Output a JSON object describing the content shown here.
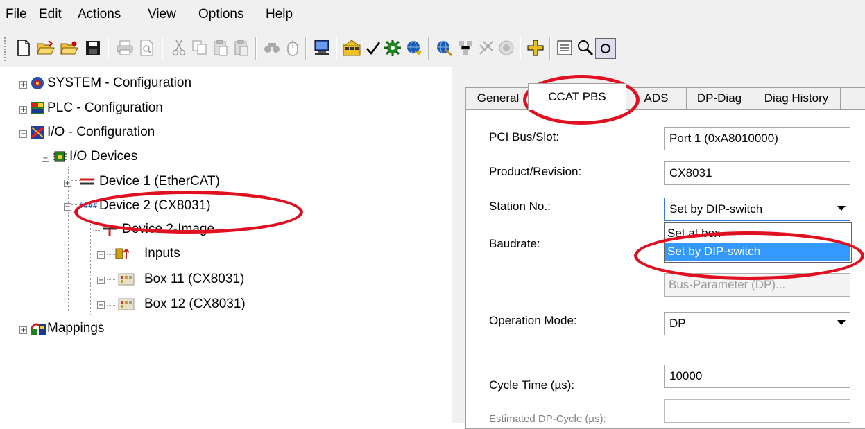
{
  "menu": [
    "File",
    "Edit",
    "Actions",
    "View",
    "Options",
    "Help"
  ],
  "toolbar_icons": [
    "new-file-icon",
    "open-file-icon",
    "open-remote-icon",
    "save-icon",
    "print-icon",
    "print-preview-icon",
    "cut-icon",
    "copy-icon",
    "paste-icon",
    "paste-special-icon",
    "find-icon",
    "mouse-icon",
    "monitor-icon",
    "activate-config-icon",
    "check-icon",
    "set-run-mode-icon",
    "free-run-icon",
    "scan-devices-icon",
    "show-online-icon",
    "stop-icon",
    "add-icon",
    "list-icon",
    "zoom-icon"
  ],
  "tree": {
    "system": "SYSTEM - Configuration",
    "plc": "PLC - Configuration",
    "io": "I/O - Configuration",
    "io_devices": "I/O Devices",
    "device1": "Device 1 (EtherCAT)",
    "device2": "Device 2 (CX8031)",
    "device2_image": "Device 2-Image",
    "inputs": "Inputs",
    "box11": "Box 11 (CX8031)",
    "box12": "Box 12 (CX8031)",
    "mappings": "Mappings"
  },
  "tabs": [
    "General",
    "CCAT PBS",
    "ADS",
    "DP-Diag",
    "Diag History",
    ""
  ],
  "active_tab": "CCAT PBS",
  "fields": {
    "pci_label": "PCI Bus/Slot:",
    "pci_value": "Port 1 (0xA8010000)",
    "product_label": "Product/Revision:",
    "product_value": "CX8031",
    "station_label": "Station No.:",
    "station_value": "Set by DIP-switch",
    "station_options": [
      "Set at box",
      "Set by DIP-switch"
    ],
    "baudrate_label": "Baudrate:",
    "bus_param_button": "Bus-Parameter (DP)...",
    "opmode_label": "Operation Mode:",
    "opmode_value": "DP",
    "cycle_label": "Cycle Time (µs):",
    "cycle_value": "10000",
    "est_label": "Estimated DP-Cycle (µs):",
    "est_value": ""
  },
  "colors": {
    "highlight": "#e01020",
    "selection": "#3399ff"
  }
}
